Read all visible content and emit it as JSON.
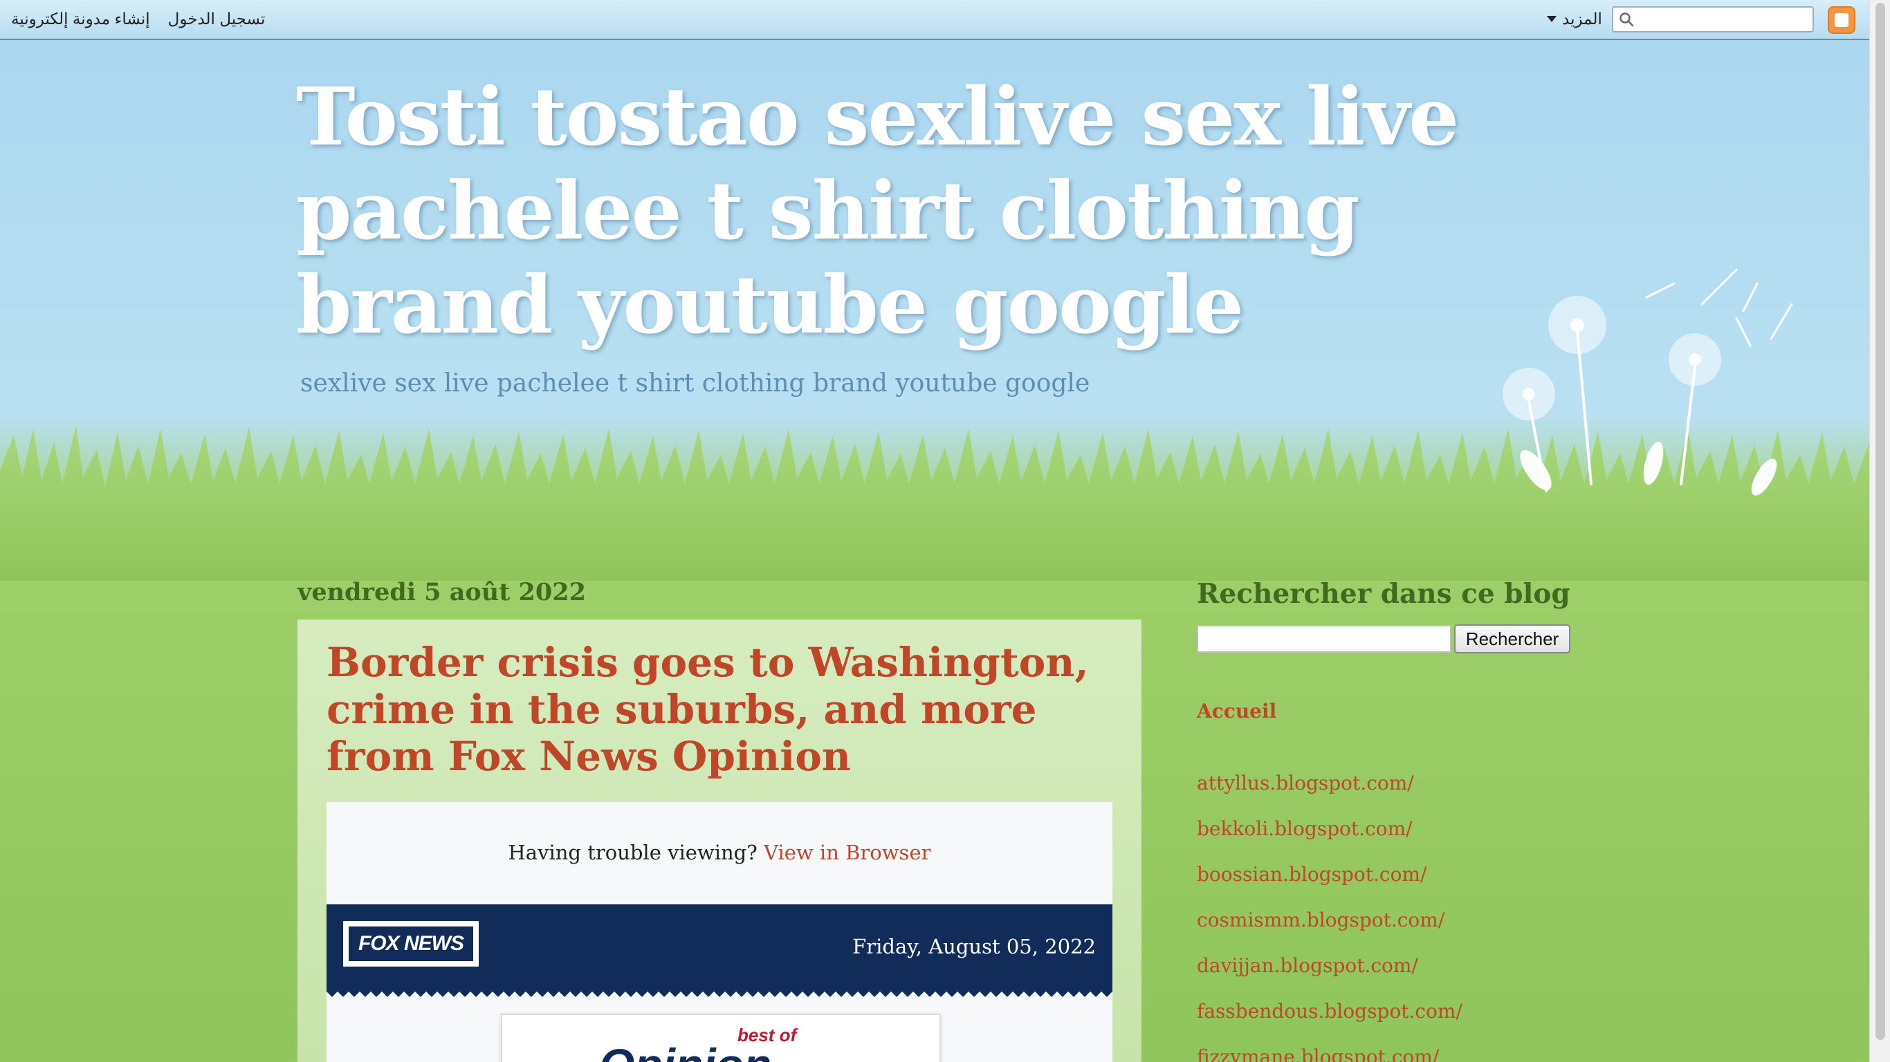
{
  "navbar": {
    "links": [
      "تسجيل الدخول",
      "إنشاء مدونة إلكترونية"
    ],
    "more_label": "المزيد",
    "search_placeholder": ""
  },
  "header": {
    "title": "Tosti tostao sexlive sex live pachelee t shirt clothing brand youtube google",
    "description": "sexlive sex live pachelee t shirt clothing brand youtube google"
  },
  "post": {
    "date": "vendredi 5 août 2022",
    "title": "Border crisis goes to Washington, crime in the suburbs, and more from Fox News Opinion",
    "email": {
      "trouble_text": "Having trouble viewing?",
      "view_link": "View in Browser",
      "logo_text": "FOX NEWS",
      "date": "Friday, August 05, 2022",
      "opinion_best": "best of",
      "opinion_word": "Opinion"
    }
  },
  "sidebar": {
    "search_title": "Rechercher dans ce blog",
    "search_button": "Rechercher",
    "home_label": "Accueil",
    "links": [
      "attyllus.blogspot.com/",
      "bekkoli.blogspot.com/",
      "boossian.blogspot.com/",
      "cosmismm.blogspot.com/",
      "davijjan.blogspot.com/",
      "fassbendous.blogspot.com/",
      "fizzymane.blogspot.com/"
    ]
  },
  "colors": {
    "link": "#c0462a",
    "heading_green": "#3f6a1f",
    "sky": "#a9d6ef",
    "grass": "#8fc55a",
    "fox_navy": "#122c5a"
  }
}
